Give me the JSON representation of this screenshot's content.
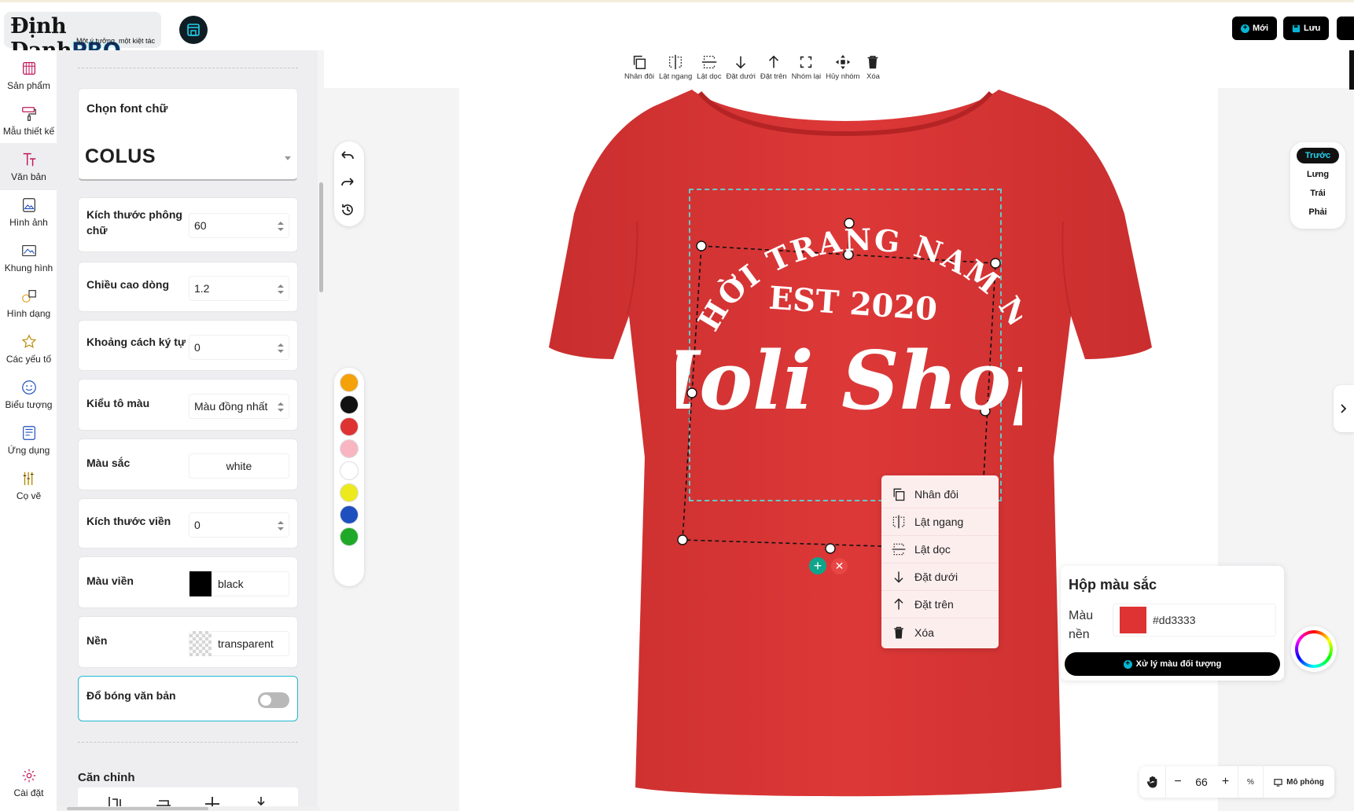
{
  "header": {
    "brand_main": "Định Danh",
    "brand_pro": "PRO",
    "slogan": "Một ý tưởng, một kiệt tác",
    "new_label": "Mới",
    "save_label": "Lưu"
  },
  "rail": {
    "items": [
      {
        "label": "Sản phẩm",
        "icon": "shirt-icon"
      },
      {
        "label": "Mẫu thiết kế",
        "icon": "paint-roller-icon"
      },
      {
        "label": "Văn bản",
        "icon": "text-icon"
      },
      {
        "label": "Hình ảnh",
        "icon": "image-icon"
      },
      {
        "label": "Khung hình",
        "icon": "frame-icon"
      },
      {
        "label": "Hình dạng",
        "icon": "shapes-icon"
      },
      {
        "label": "Các yếu tố",
        "icon": "star-icon"
      },
      {
        "label": "Biểu tượng",
        "icon": "emoji-icon"
      },
      {
        "label": "Ứng dụng",
        "icon": "app-icon"
      },
      {
        "label": "Cọ vẽ",
        "icon": "brush-icon"
      }
    ],
    "settings_label": "Cài đặt"
  },
  "panel": {
    "font_title": "Chọn font chữ",
    "font_value": "COLUS",
    "font_size_label": "Kích thước phông chữ",
    "font_size_value": "60",
    "line_height_label": "Chiều cao dòng",
    "line_height_value": "1.2",
    "letter_spacing_label": "Khoảng cách ký tự",
    "letter_spacing_value": "0",
    "fill_type_label": "Kiểu tô màu",
    "fill_type_value": "Màu đồng nhất",
    "color_label": "Màu sắc",
    "color_value": "white",
    "stroke_size_label": "Kích thước viền",
    "stroke_size_value": "0",
    "stroke_color_label": "Màu viền",
    "stroke_color_value": "black",
    "background_label": "Nền",
    "background_value": "transparent",
    "shadow_label": "Đổ bóng văn bản",
    "shadow_on": false,
    "align_label": "Căn chỉnh"
  },
  "toolbar": {
    "actions": [
      {
        "label": "Nhân đôi",
        "icon": "duplicate-icon"
      },
      {
        "label": "Lật ngang",
        "icon": "flip-horizontal-icon"
      },
      {
        "label": "Lật dọc",
        "icon": "flip-vertical-icon"
      },
      {
        "label": "Đặt dưới",
        "icon": "send-backward-icon"
      },
      {
        "label": "Đặt trên",
        "icon": "bring-forward-icon"
      },
      {
        "label": "Nhóm lại",
        "icon": "group-icon"
      },
      {
        "label": "Hủy nhóm",
        "icon": "ungroup-icon"
      },
      {
        "label": "Xóa",
        "icon": "trash-icon"
      }
    ]
  },
  "palette": [
    "#f5a10a",
    "#111111",
    "#dd3333",
    "#f7b6c2",
    "#ffffff",
    "#ecea1c",
    "#1d4fbf",
    "#20a928"
  ],
  "design": {
    "arc_text": "THỜI TRANG NAM NỮ",
    "est_text": "EST 2020",
    "main_text": "Holi Shop",
    "shirt_color": "#dd3333"
  },
  "views": {
    "items": [
      "Trước",
      "Lưng",
      "Trái",
      "Phải"
    ],
    "active": "Trước"
  },
  "context_menu": {
    "items": [
      {
        "label": "Nhân đôi",
        "icon": "duplicate-icon"
      },
      {
        "label": "Lật ngang",
        "icon": "flip-horizontal-icon"
      },
      {
        "label": "Lật dọc",
        "icon": "flip-vertical-icon"
      },
      {
        "label": "Đặt dưới",
        "icon": "send-backward-icon"
      },
      {
        "label": "Đặt trên",
        "icon": "bring-forward-icon"
      },
      {
        "label": "Xóa",
        "icon": "trash-icon"
      }
    ]
  },
  "color_box": {
    "title": "Hộp màu sắc",
    "bg_label": "Màu nền",
    "bg_value": "#dd3333",
    "process_label": "Xử lý màu đối tượng"
  },
  "zoom": {
    "value": "66",
    "unit": "%",
    "simulate_label": "Mô phỏng"
  }
}
